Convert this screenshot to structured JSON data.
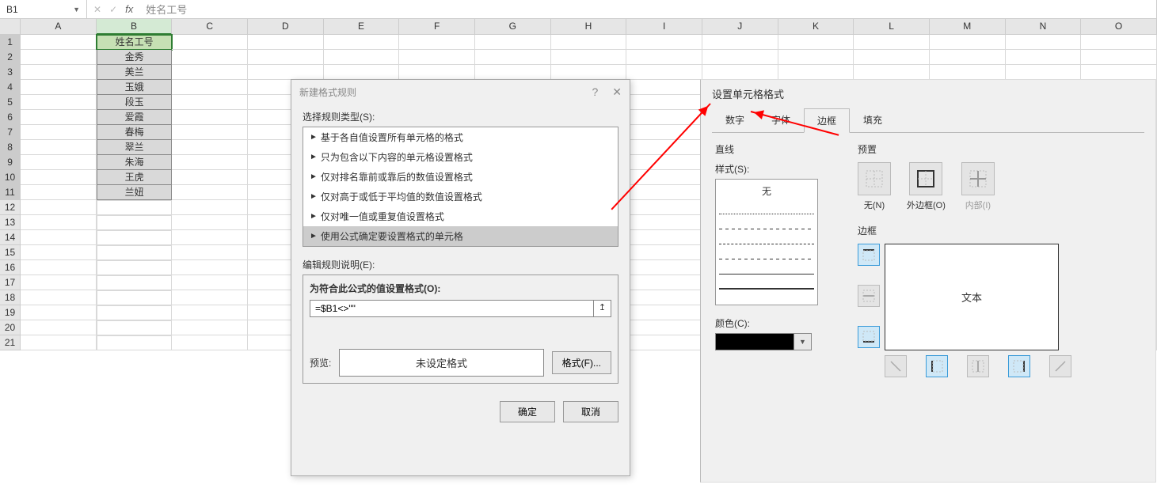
{
  "formula_bar": {
    "cell_ref": "B1",
    "fx_value": "姓名工号"
  },
  "columns": [
    "A",
    "B",
    "C",
    "D",
    "E",
    "F",
    "G",
    "H",
    "I",
    "J",
    "K",
    "L",
    "M",
    "N",
    "O"
  ],
  "row_count": 21,
  "col_b_data": [
    "姓名工号",
    "金秀",
    "美兰",
    "玉娥",
    "段玉",
    "爱霞",
    "春梅",
    "翠兰",
    "朱海",
    "王虎",
    "兰妞"
  ],
  "dialog1": {
    "title": "新建格式规则",
    "select_type_label": "选择规则类型(S):",
    "rule_types": [
      "基于各自值设置所有单元格的格式",
      "只为包含以下内容的单元格设置格式",
      "仅对排名靠前或靠后的数值设置格式",
      "仅对高于或低于平均值的数值设置格式",
      "仅对唯一值或重复值设置格式",
      "使用公式确定要设置格式的单元格"
    ],
    "selected_rule_index": 5,
    "edit_desc_label": "编辑规则说明(E):",
    "formula_label": "为符合此公式的值设置格式(O):",
    "formula_value": "=$B1<>\"\"",
    "preview_label": "预览:",
    "preview_text": "未设定格式",
    "format_btn": "格式(F)...",
    "ok_btn": "确定",
    "cancel_btn": "取消"
  },
  "dialog2": {
    "title": "设置单元格格式",
    "tabs": [
      "数字",
      "字体",
      "边框",
      "填充"
    ],
    "active_tab_index": 2,
    "lines_label": "直线",
    "style_label": "样式(S):",
    "style_none": "无",
    "color_label": "颜色(C):",
    "color_value": "#000000",
    "preset_label": "预置",
    "presets": [
      {
        "label": "无(N)"
      },
      {
        "label": "外边框(O)"
      },
      {
        "label": "内部(I)",
        "disabled": true
      }
    ],
    "border_label": "边框",
    "preview_text": "文本"
  }
}
